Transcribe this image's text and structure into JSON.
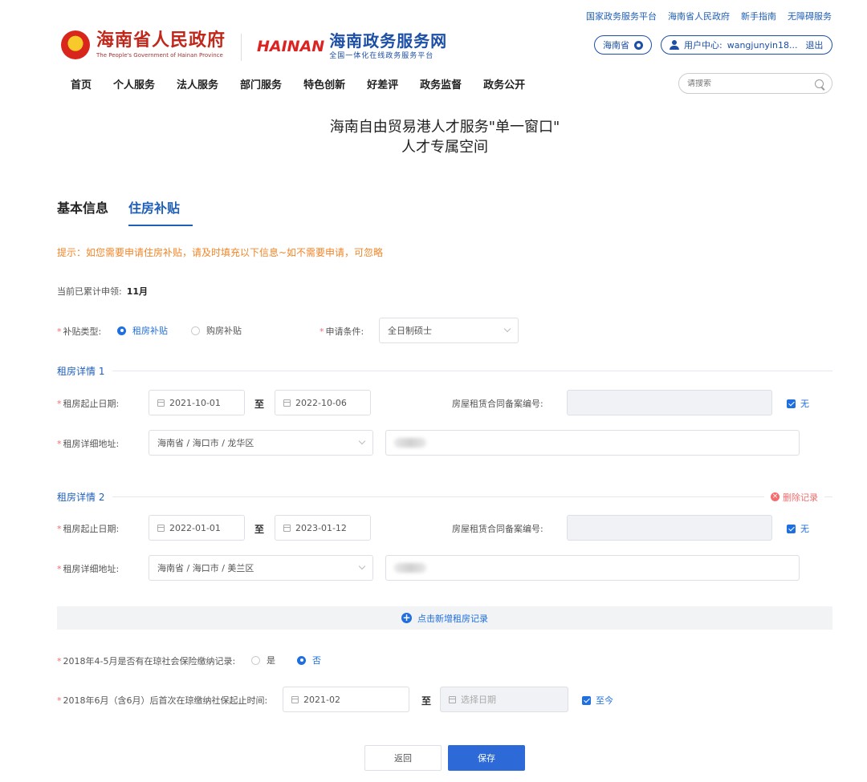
{
  "top_links": [
    "国家政务服务平台",
    "海南省人民政府",
    "新手指南",
    "无障碍服务"
  ],
  "header": {
    "gov_title": "海南省人民政府",
    "gov_subtitle_en": "The People's Government of Hainan Province",
    "hainan_logo": "HAINAN",
    "service_title": "海南政务服务网",
    "service_subtitle": "全国一体化在线政务服务平台",
    "region": "海南省",
    "user_center_label": "用户中心:",
    "username": "wangjunyin18...",
    "logout": "退出"
  },
  "nav": [
    "首页",
    "个人服务",
    "法人服务",
    "部门服务",
    "特色创新",
    "好差评",
    "政务监督",
    "政务公开"
  ],
  "search": {
    "placeholder": "请搜索"
  },
  "page_title_line1": "海南自由贸易港人才服务\"单一窗口\"",
  "page_title_line2": "人才专属空间",
  "tabs": {
    "basic": "基本信息",
    "housing": "住房补贴"
  },
  "hint": "提示：如您需要申请住房补贴，请及时填充以下信息~如不需要申请，可忽略",
  "count": {
    "label": "当前已累计申领:",
    "value": "11月"
  },
  "subsidy": {
    "type_label": "补贴类型:",
    "options": [
      "租房补贴",
      "购房补贴"
    ],
    "selected": "租房补贴",
    "condition_label": "申请条件:",
    "condition_value": "全日制硕士"
  },
  "records": [
    {
      "title": "租房详情 1",
      "date_label": "租房起止日期:",
      "start": "2021-10-01",
      "to": "至",
      "end": "2022-10-06",
      "contract_label": "房屋租赁合同备案编号:",
      "none_label": "无",
      "address_label": "租房详细地址:",
      "region": "海南省 / 海口市 / 龙华区"
    },
    {
      "title": "租房详情 2",
      "delete_label": "删除记录",
      "date_label": "租房起止日期:",
      "start": "2022-01-01",
      "to": "至",
      "end": "2023-01-12",
      "contract_label": "房屋租赁合同备案编号:",
      "none_label": "无",
      "address_label": "租房详细地址:",
      "region": "海南省 / 海口市 / 美兰区"
    }
  ],
  "add_record": "点击新增租房记录",
  "social_insurance": {
    "label": "2018年4-5月是否有在琼社会保险缴纳记录:",
    "options": [
      "是",
      "否"
    ],
    "selected": "否"
  },
  "first_pay": {
    "label": "2018年6月（含6月）后首次在琼缴纳社保起止时间:",
    "start": "2021-02",
    "to": "至",
    "end_placeholder": "选择日期",
    "until_now": "至今"
  },
  "buttons": {
    "back": "返回",
    "save": "保存"
  },
  "colors": {
    "primary": "#1f6fe0",
    "brand_red": "#c0281c",
    "brand_blue": "#1c4fa5",
    "warning": "#f0862a",
    "danger": "#f56c6c"
  }
}
